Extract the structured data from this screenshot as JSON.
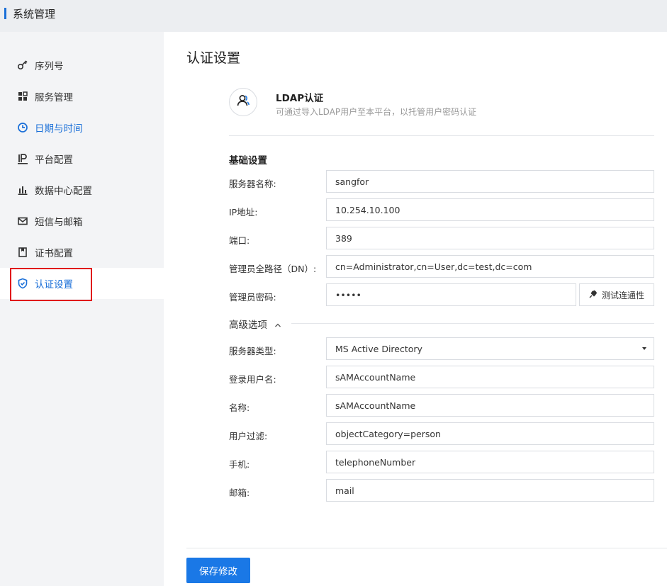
{
  "topbar": {
    "title": "系统管理"
  },
  "sidebar": {
    "items": [
      {
        "label": "序列号",
        "icon": "key-icon"
      },
      {
        "label": "服务管理",
        "icon": "grid-icon"
      },
      {
        "label": "日期与时间",
        "icon": "clock-icon"
      },
      {
        "label": "平台配置",
        "icon": "ip-icon"
      },
      {
        "label": "数据中心配置",
        "icon": "bar-chart-icon"
      },
      {
        "label": "短信与邮箱",
        "icon": "mail-icon"
      },
      {
        "label": "证书配置",
        "icon": "certificate-icon"
      },
      {
        "label": "认证设置",
        "icon": "shield-icon"
      }
    ]
  },
  "main": {
    "title": "认证设置",
    "ldap": {
      "title": "LDAP认证",
      "desc": "可通过导入LDAP用户至本平台，以托管用户密码认证"
    },
    "basic": {
      "title": "基础设置",
      "fields": [
        {
          "label": "服务器名称:",
          "value": "sangfor"
        },
        {
          "label": "IP地址:",
          "value": "10.254.10.100"
        },
        {
          "label": "端口:",
          "value": "389"
        },
        {
          "label": "管理员全路径（DN）:",
          "value": "cn=Administrator,cn=User,dc=test,dc=com"
        },
        {
          "label": "管理员密码:",
          "value": "•••••"
        }
      ],
      "test_button": "测试连通性"
    },
    "advanced": {
      "title": "高级选项",
      "fields": [
        {
          "label": "服务器类型:",
          "value": "MS Active Directory"
        },
        {
          "label": "登录用户名:",
          "value": "sAMAccountName"
        },
        {
          "label": "名称:",
          "value": "sAMAccountName"
        },
        {
          "label": "用户过滤:",
          "value": "objectCategory=person"
        },
        {
          "label": "手机:",
          "value": "telephoneNumber"
        },
        {
          "label": "邮箱:",
          "value": "mail"
        }
      ]
    },
    "save_label": "保存修改"
  },
  "colors": {
    "accent": "#1a78e6",
    "active_text": "#1a6fd8",
    "highlight": "#e0161b"
  }
}
